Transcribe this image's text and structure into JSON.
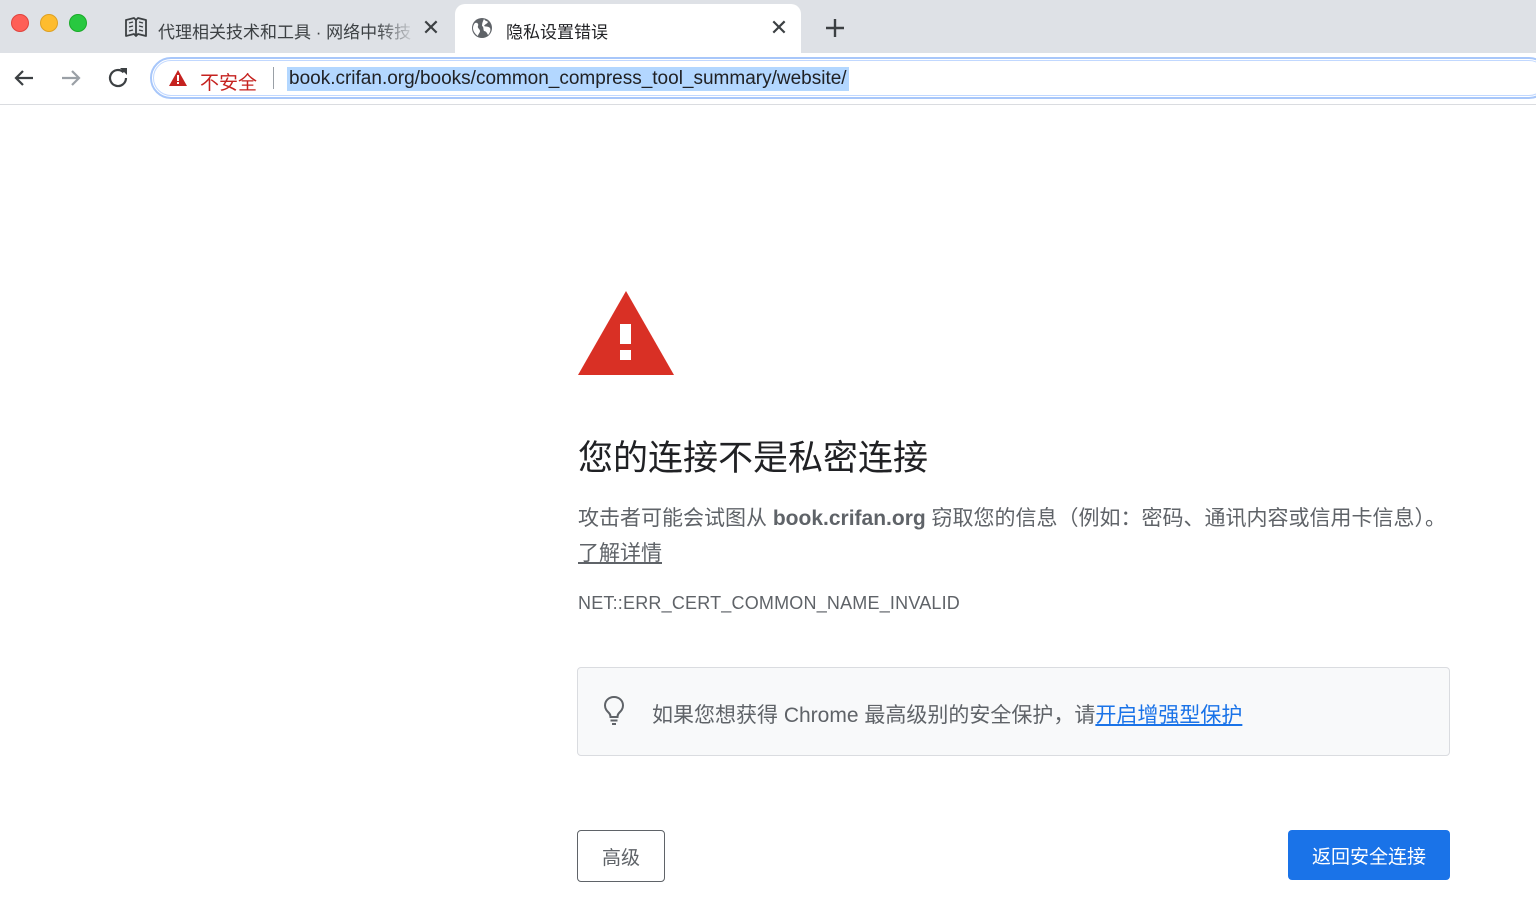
{
  "tabs": [
    {
      "title": "代理相关技术和工具 · 网络中转技",
      "icon": "book-icon",
      "active": false
    },
    {
      "title": "隐私设置错误",
      "icon": "globe-icon",
      "active": true
    }
  ],
  "toolbar": {
    "security_label": "不安全",
    "url": "book.crifan.org/books/common_compress_tool_summary/website/"
  },
  "interstitial": {
    "heading": "您的连接不是私密连接",
    "message_prefix": "攻击者可能会试图从 ",
    "message_host": "book.crifan.org",
    "message_suffix": " 窃取您的信息（例如：密码、通讯内容或信用卡信息）。",
    "learn_more": "了解详情",
    "error_code": "NET::ERR_CERT_COMMON_NAME_INVALID",
    "enhanced_text": "如果您想获得 Chrome 最高级别的安全保护，请",
    "enhanced_link": "开启增强型保护",
    "advanced_button": "高级",
    "back_button": "返回安全连接"
  },
  "colors": {
    "tabstrip_bg": "#dee1e6",
    "warning_red": "#d93025",
    "not_secure_red": "#c5221f",
    "primary_blue": "#1a73e8",
    "url_selection": "#b3d7ff"
  }
}
